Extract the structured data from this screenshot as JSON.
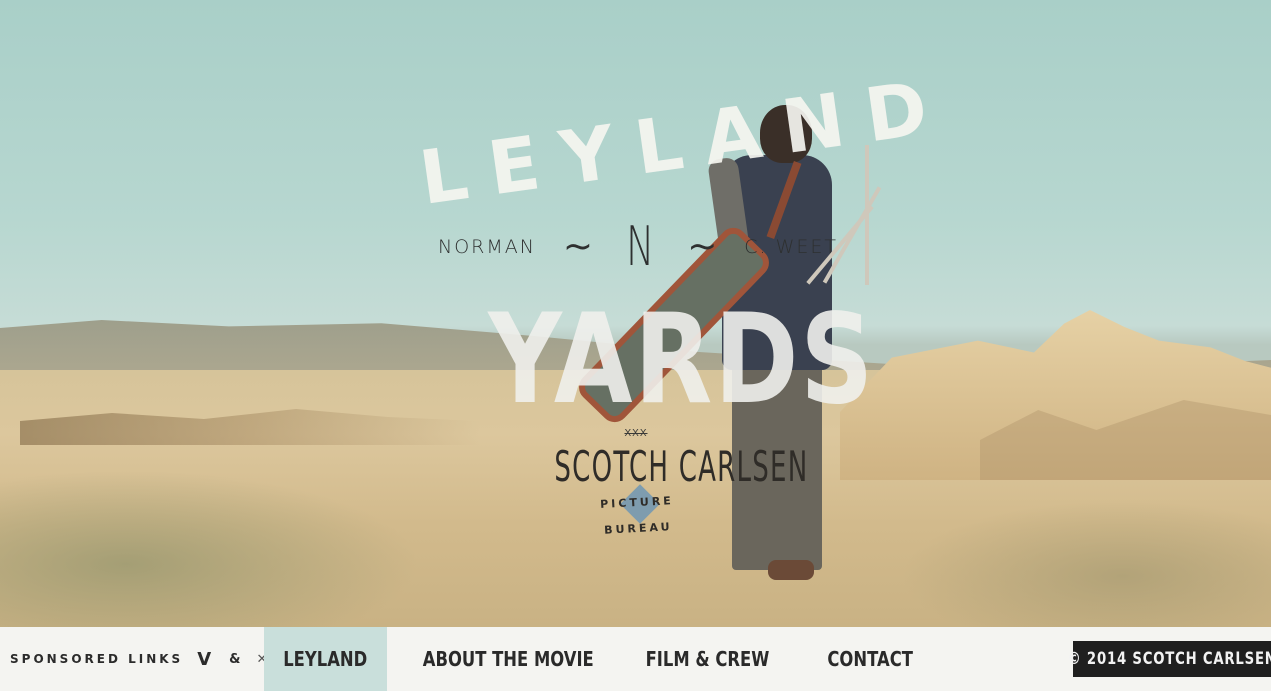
{
  "hero": {
    "title_top": "LEYLAND",
    "title_bottom": "YARDS",
    "credit_left": "NORMAN",
    "credit_right": "C. WEET",
    "monogram": "N",
    "tilde": "~",
    "studio_mark": "XXX",
    "studio_name": "SCOTCH CARLSEN",
    "studio_sub": "PICTURE BUREAU"
  },
  "footer": {
    "sponsored_label": "SPONSORED LINKS",
    "sponsor_icons": [
      "vimeo-icon",
      "xc-icon"
    ],
    "sponsor_vimeo_glyph": "V",
    "sponsor_amp": "&",
    "sponsor_xc_glyph": "✕c",
    "nav": [
      {
        "label": "LEYLAND",
        "active": true
      },
      {
        "label": "ABOUT THE MOVIE",
        "active": false
      },
      {
        "label": "FILM & CREW",
        "active": false
      },
      {
        "label": "CONTACT",
        "active": false
      }
    ],
    "copyright": "© 2014 SCOTCH CARLSEN"
  },
  "colors": {
    "nav_active_bg": "#c9dfdb",
    "nav_bg": "#f4f4f1",
    "copyright_bg": "#1f1f1f",
    "sky": "#a9cfc8",
    "ground": "#dcc79d"
  }
}
